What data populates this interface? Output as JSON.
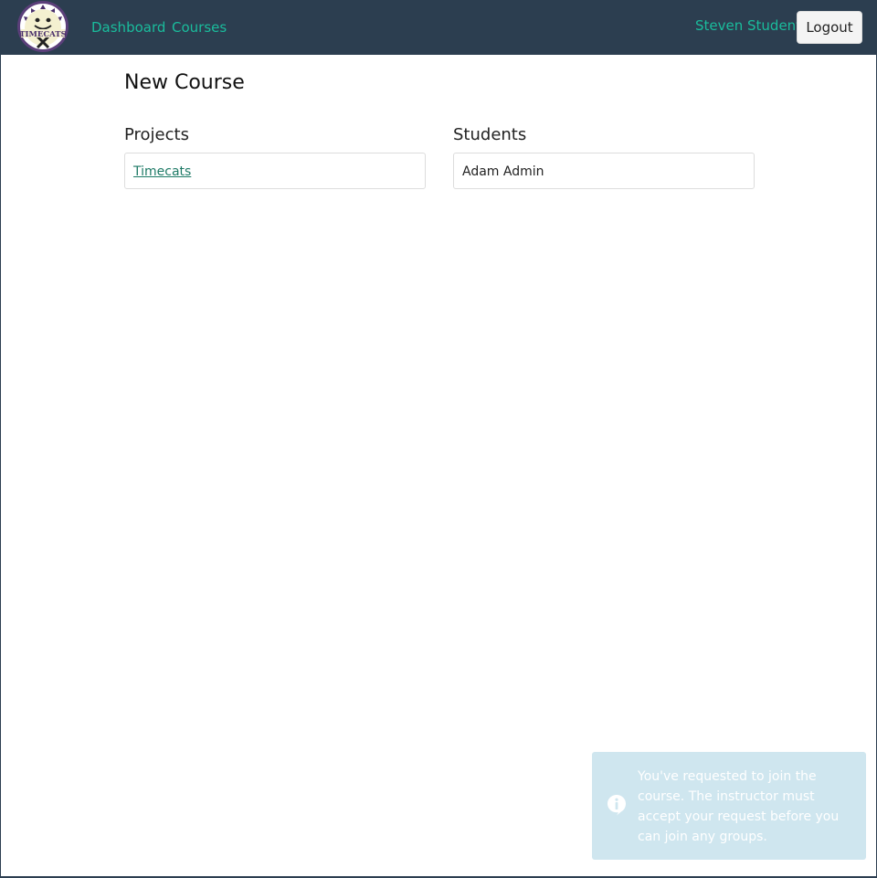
{
  "navbar": {
    "logo_text": "TIMECATS",
    "links": [
      {
        "label": "Dashboard"
      },
      {
        "label": "Courses"
      }
    ],
    "user_name": "Steven Student",
    "logout_label": "Logout"
  },
  "page": {
    "title": "New Course",
    "projects": {
      "heading": "Projects",
      "items": [
        "Timecats"
      ]
    },
    "students": {
      "heading": "Students",
      "items": [
        "Adam Admin"
      ]
    }
  },
  "toast": {
    "icon": "info-icon",
    "message": "You've requested to join the course. The instructor must accept your request before you can join any groups."
  },
  "colors": {
    "navbar_bg": "#2c3e50",
    "accent": "#1abc9c",
    "toast_bg": "#cfe6ef"
  }
}
